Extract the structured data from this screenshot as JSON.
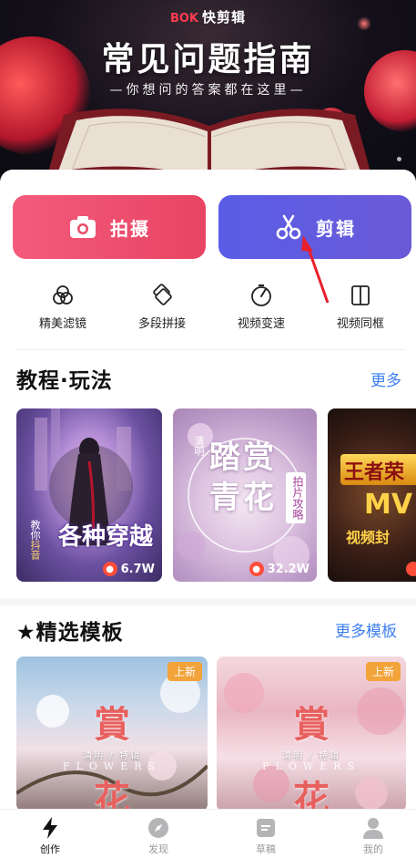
{
  "banner": {
    "brand_logo": "BOK",
    "brand_name": "快剪辑",
    "title": "常见问题指南",
    "subtitle": "—你想问的答案都在这里—"
  },
  "actions": {
    "shoot_label": "拍摄",
    "edit_label": "剪辑"
  },
  "tools": [
    {
      "label": "精美滤镜",
      "icon": "filter-icon"
    },
    {
      "label": "多段拼接",
      "icon": "splice-icon"
    },
    {
      "label": "视频变速",
      "icon": "speed-icon"
    },
    {
      "label": "视频同框",
      "icon": "split-frame-icon"
    }
  ],
  "tutorials": {
    "title": "教程·玩法",
    "more": "更多",
    "cards": [
      {
        "line1": "教你",
        "line2": "抖音",
        "title": "各种穿越",
        "views": "6.7W"
      },
      {
        "line1": "清明",
        "title_top": "踏赏",
        "title_bottom": "青花",
        "tag": "拍片攻略",
        "views": "32.2W"
      },
      {
        "title": "王者荣",
        "sub": "MV",
        "caption": "视频封",
        "views": ""
      }
    ]
  },
  "templates": {
    "title": "★精选模板",
    "more": "更多模板",
    "cards": [
      {
        "tag": "上新",
        "char1": "賞",
        "small": "清明 / 特辑",
        "eng": "FLOWERS",
        "char2": "花"
      },
      {
        "tag": "上新",
        "char1": "賞",
        "small": "清明 / 特辑",
        "eng": "FLOWERS",
        "char2": "花"
      }
    ]
  },
  "nav": [
    {
      "label": "创作",
      "icon": "lightning-icon",
      "active": true
    },
    {
      "label": "发现",
      "icon": "compass-icon",
      "active": false
    },
    {
      "label": "草稿",
      "icon": "draft-icon",
      "active": false
    },
    {
      "label": "我的",
      "icon": "profile-icon",
      "active": false
    }
  ],
  "colors": {
    "shoot": "#e84463",
    "edit": "#5a5ce6",
    "link": "#3d7ff2",
    "new_tag": "#f2a33a"
  }
}
